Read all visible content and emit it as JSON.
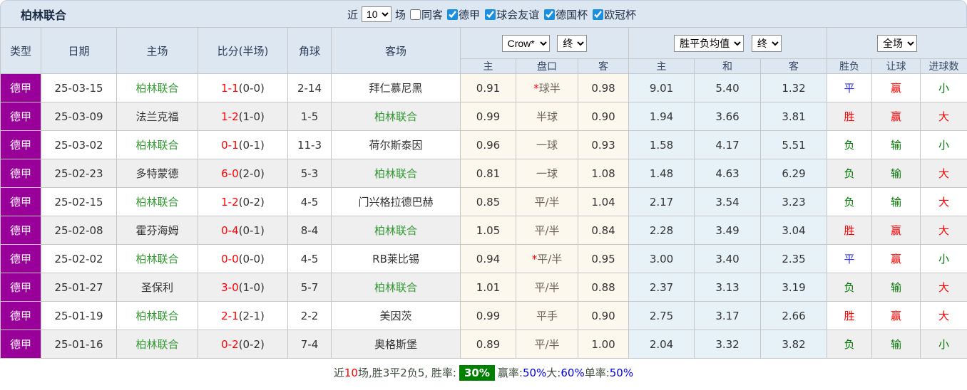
{
  "colors": {
    "purple": "#990099",
    "team_green": "#339933",
    "result_red": "#ff0000",
    "result_blue": "#2f2fe0",
    "result_green": "#007700",
    "handicap_bg": "#fcf8ee",
    "avg_bg": "#e7f2f8",
    "header_bg": "#dde7f2",
    "badge_green": "#008000"
  },
  "topbar": {
    "title": "柏林联合",
    "recent_label": "近",
    "recent_value": "10",
    "games_label": "场",
    "same_opponent_label": "同客",
    "leagues": [
      {
        "label": "德甲",
        "checked": true
      },
      {
        "label": "球会友谊",
        "checked": true
      },
      {
        "label": "德国杯",
        "checked": true
      },
      {
        "label": "欧冠杯",
        "checked": true
      }
    ]
  },
  "header": {
    "cols": [
      "类型",
      "日期",
      "主场",
      "比分(半场)",
      "角球",
      "客场"
    ],
    "ah_group": {
      "bookmaker": "Crow*",
      "period": "终"
    },
    "odds_group": {
      "name": "胜平负均值",
      "period": "终"
    },
    "result_group": {
      "name": "全场"
    },
    "sub": [
      "主",
      "盘口",
      "客",
      "主",
      "和",
      "客",
      "胜负",
      "让球",
      "进球数"
    ]
  },
  "table": {
    "rows": [
      {
        "league": "德甲",
        "date": "25-03-15",
        "home": "柏林联合",
        "home_target": true,
        "ft": "1-1",
        "ht": "(0-0)",
        "corners": "2-14",
        "away": "拜仁慕尼黑",
        "away_target": false,
        "ah_home": "0.91",
        "ah_line": "球半",
        "ah_star": true,
        "ah_away": "0.98",
        "avg_home": "9.01",
        "avg_draw": "5.40",
        "avg_away": "1.32",
        "res_wdl": {
          "text": "平",
          "color": "blue"
        },
        "res_ah": {
          "text": "赢",
          "color": "red"
        },
        "res_ou": {
          "text": "小",
          "color": "green"
        }
      },
      {
        "league": "德甲",
        "date": "25-03-09",
        "home": "法兰克福",
        "home_target": false,
        "ft": "1-2",
        "ht": "(1-0)",
        "corners": "1-5",
        "away": "柏林联合",
        "away_target": true,
        "ah_home": "0.99",
        "ah_line": "半球",
        "ah_star": false,
        "ah_away": "0.90",
        "avg_home": "1.94",
        "avg_draw": "3.66",
        "avg_away": "3.81",
        "res_wdl": {
          "text": "胜",
          "color": "red"
        },
        "res_ah": {
          "text": "赢",
          "color": "red"
        },
        "res_ou": {
          "text": "大",
          "color": "red"
        }
      },
      {
        "league": "德甲",
        "date": "25-03-02",
        "home": "柏林联合",
        "home_target": true,
        "ft": "0-1",
        "ht": "(0-1)",
        "corners": "11-3",
        "away": "荷尔斯泰因",
        "away_target": false,
        "ah_home": "0.96",
        "ah_line": "一球",
        "ah_star": false,
        "ah_away": "0.93",
        "avg_home": "1.58",
        "avg_draw": "4.17",
        "avg_away": "5.51",
        "res_wdl": {
          "text": "负",
          "color": "green"
        },
        "res_ah": {
          "text": "输",
          "color": "green"
        },
        "res_ou": {
          "text": "小",
          "color": "green"
        }
      },
      {
        "league": "德甲",
        "date": "25-02-23",
        "home": "多特蒙德",
        "home_target": false,
        "ft": "6-0",
        "ht": "(2-0)",
        "corners": "5-3",
        "away": "柏林联合",
        "away_target": true,
        "ah_home": "0.81",
        "ah_line": "一球",
        "ah_star": false,
        "ah_away": "1.08",
        "avg_home": "1.48",
        "avg_draw": "4.63",
        "avg_away": "6.29",
        "res_wdl": {
          "text": "负",
          "color": "green"
        },
        "res_ah": {
          "text": "输",
          "color": "green"
        },
        "res_ou": {
          "text": "大",
          "color": "red"
        }
      },
      {
        "league": "德甲",
        "date": "25-02-15",
        "home": "柏林联合",
        "home_target": true,
        "ft": "1-2",
        "ht": "(0-2)",
        "corners": "4-5",
        "away": "门兴格拉德巴赫",
        "away_target": false,
        "ah_home": "0.85",
        "ah_line": "平/半",
        "ah_star": false,
        "ah_away": "1.04",
        "avg_home": "2.17",
        "avg_draw": "3.54",
        "avg_away": "3.23",
        "res_wdl": {
          "text": "负",
          "color": "green"
        },
        "res_ah": {
          "text": "输",
          "color": "green"
        },
        "res_ou": {
          "text": "大",
          "color": "red"
        }
      },
      {
        "league": "德甲",
        "date": "25-02-08",
        "home": "霍芬海姆",
        "home_target": false,
        "ft": "0-4",
        "ht": "(0-1)",
        "corners": "8-4",
        "away": "柏林联合",
        "away_target": true,
        "ah_home": "1.05",
        "ah_line": "平/半",
        "ah_star": false,
        "ah_away": "0.84",
        "avg_home": "2.28",
        "avg_draw": "3.49",
        "avg_away": "3.04",
        "res_wdl": {
          "text": "胜",
          "color": "red"
        },
        "res_ah": {
          "text": "赢",
          "color": "red"
        },
        "res_ou": {
          "text": "大",
          "color": "red"
        }
      },
      {
        "league": "德甲",
        "date": "25-02-02",
        "home": "柏林联合",
        "home_target": true,
        "ft": "0-0",
        "ht": "(0-0)",
        "corners": "4-5",
        "away": "RB莱比锡",
        "away_target": false,
        "ah_home": "0.94",
        "ah_line": "平/半",
        "ah_star": true,
        "ah_away": "0.95",
        "avg_home": "3.00",
        "avg_draw": "3.40",
        "avg_away": "2.35",
        "res_wdl": {
          "text": "平",
          "color": "blue"
        },
        "res_ah": {
          "text": "赢",
          "color": "red"
        },
        "res_ou": {
          "text": "小",
          "color": "green"
        }
      },
      {
        "league": "德甲",
        "date": "25-01-27",
        "home": "圣保利",
        "home_target": false,
        "ft": "3-0",
        "ht": "(1-0)",
        "corners": "5-7",
        "away": "柏林联合",
        "away_target": true,
        "ah_home": "1.01",
        "ah_line": "平/半",
        "ah_star": false,
        "ah_away": "0.88",
        "avg_home": "2.37",
        "avg_draw": "3.13",
        "avg_away": "3.19",
        "res_wdl": {
          "text": "负",
          "color": "green"
        },
        "res_ah": {
          "text": "输",
          "color": "green"
        },
        "res_ou": {
          "text": "大",
          "color": "red"
        }
      },
      {
        "league": "德甲",
        "date": "25-01-19",
        "home": "柏林联合",
        "home_target": true,
        "ft": "2-1",
        "ht": "(2-1)",
        "corners": "2-2",
        "away": "美因茨",
        "away_target": false,
        "ah_home": "0.99",
        "ah_line": "平手",
        "ah_star": false,
        "ah_away": "0.90",
        "avg_home": "2.75",
        "avg_draw": "3.17",
        "avg_away": "2.66",
        "res_wdl": {
          "text": "胜",
          "color": "red"
        },
        "res_ah": {
          "text": "赢",
          "color": "red"
        },
        "res_ou": {
          "text": "大",
          "color": "red"
        }
      },
      {
        "league": "德甲",
        "date": "25-01-16",
        "home": "柏林联合",
        "home_target": true,
        "ft": "0-2",
        "ht": "(0-2)",
        "corners": "7-4",
        "away": "奥格斯堡",
        "away_target": false,
        "ah_home": "0.89",
        "ah_line": "平/半",
        "ah_star": false,
        "ah_away": "1.00",
        "avg_home": "2.04",
        "avg_draw": "3.32",
        "avg_away": "3.82",
        "res_wdl": {
          "text": "负",
          "color": "green"
        },
        "res_ah": {
          "text": "输",
          "color": "green"
        },
        "res_ou": {
          "text": "小",
          "color": "green"
        }
      }
    ]
  },
  "footer": {
    "segments": [
      {
        "text": "近",
        "style": "plain"
      },
      {
        "text": "10",
        "style": "red"
      },
      {
        "text": "场,胜3平2负5, 胜率:",
        "style": "plain"
      },
      {
        "text": "30%",
        "style": "badge"
      },
      {
        "text": " 赢率:",
        "style": "plain"
      },
      {
        "text": "50%",
        "style": "blue"
      },
      {
        "text": " 大:",
        "style": "plain"
      },
      {
        "text": "60%",
        "style": "blue"
      },
      {
        "text": " 单率:",
        "style": "plain"
      },
      {
        "text": "50%",
        "style": "blue"
      }
    ]
  }
}
